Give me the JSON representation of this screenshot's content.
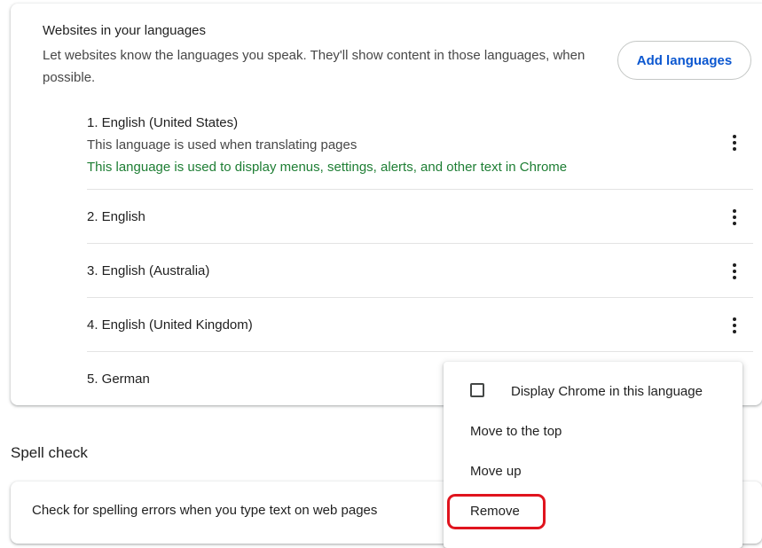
{
  "languages_section": {
    "title": "Websites in your languages",
    "description": "Let websites know the languages you speak. They'll show content in those languages, when possible.",
    "add_button_label": "Add languages",
    "items": [
      {
        "label": "1. English (United States)",
        "note": "This language is used when translating pages",
        "ui_note": "This language is used to display menus, settings, alerts, and other text in Chrome"
      },
      {
        "label": "2. English"
      },
      {
        "label": "3. English (Australia)"
      },
      {
        "label": "4. English (United Kingdom)"
      },
      {
        "label": "5. German"
      }
    ],
    "more_actions_icon": "vertical-dots-icon"
  },
  "spell_check": {
    "heading": "Spell check",
    "toggle_label": "Check for spelling errors when you type text on web pages"
  },
  "context_menu": {
    "items": [
      {
        "label": "Display Chrome in this language",
        "type": "checkbox",
        "checked": false
      },
      {
        "label": "Move to the top"
      },
      {
        "label": "Move up"
      },
      {
        "label": "Remove",
        "highlighted": true
      }
    ]
  },
  "colors": {
    "accent": "#0b57d0",
    "ui_language_note": "#1e7e34",
    "highlight_outline": "#e0141e",
    "divider": "#e3e3e3"
  }
}
